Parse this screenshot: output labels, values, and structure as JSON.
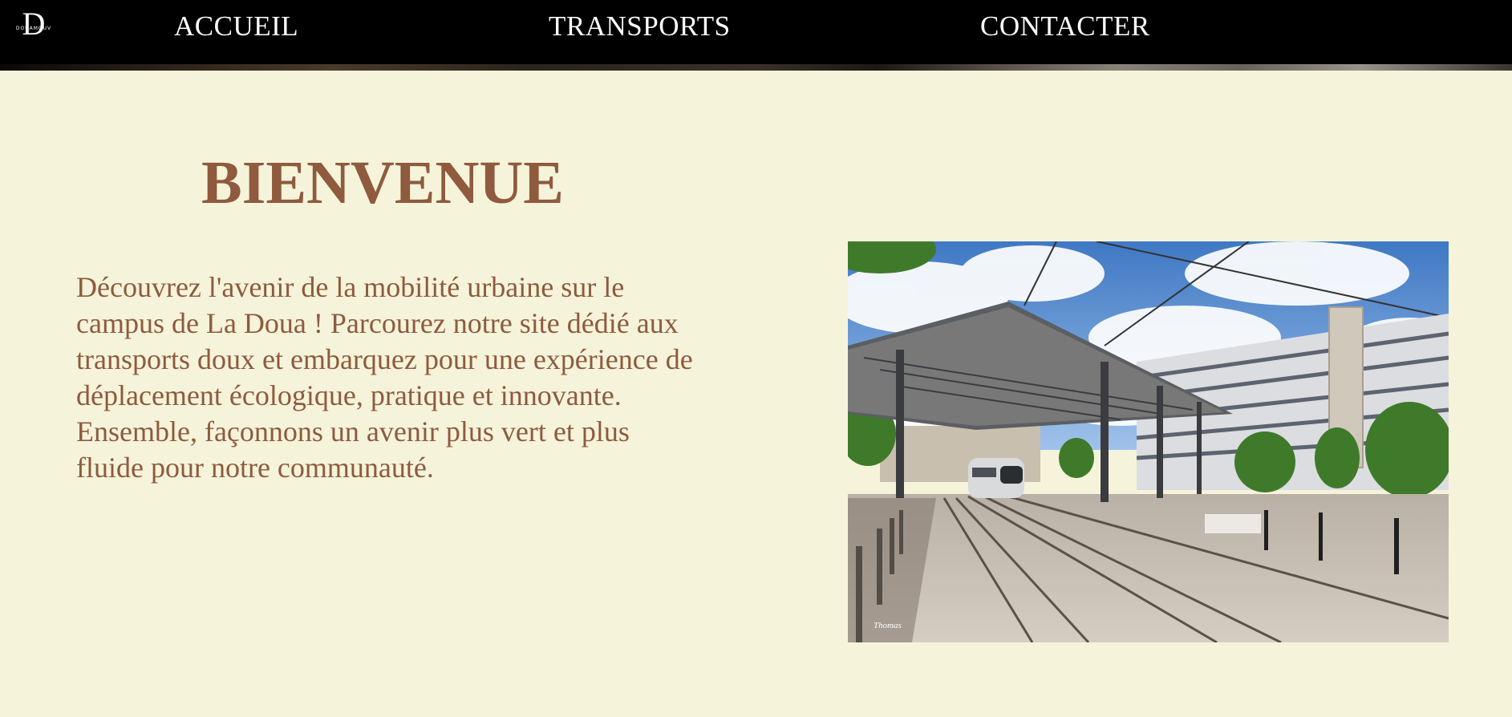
{
  "nav": {
    "logo_letter": "D",
    "logo_text": "DOUAMOUV",
    "links": [
      {
        "label": "ACCUEIL"
      },
      {
        "label": "TRANSPORTS"
      },
      {
        "label": "CONTACTER"
      }
    ]
  },
  "main": {
    "title": "BIENVENUE",
    "intro": "Découvrez l'avenir de la mobilité urbaine sur le campus de La Doua ! Parcourez notre site dédié aux transports doux et embarquez pour une expérience de déplacement écologique, pratique et innovante. Ensemble, façonnons un avenir plus vert et plus fluide pour notre communauté.",
    "image": {
      "credit": "Thomas",
      "colors": {
        "sky": "#5a8fd0",
        "cloud": "#ffffff",
        "building": "#d8d8d8",
        "ground": "#c8beb4",
        "tree": "#3f7a2a"
      }
    }
  },
  "colors": {
    "background": "#f5f4da",
    "accent": "#8f5a3e",
    "navbar": "#000000"
  }
}
